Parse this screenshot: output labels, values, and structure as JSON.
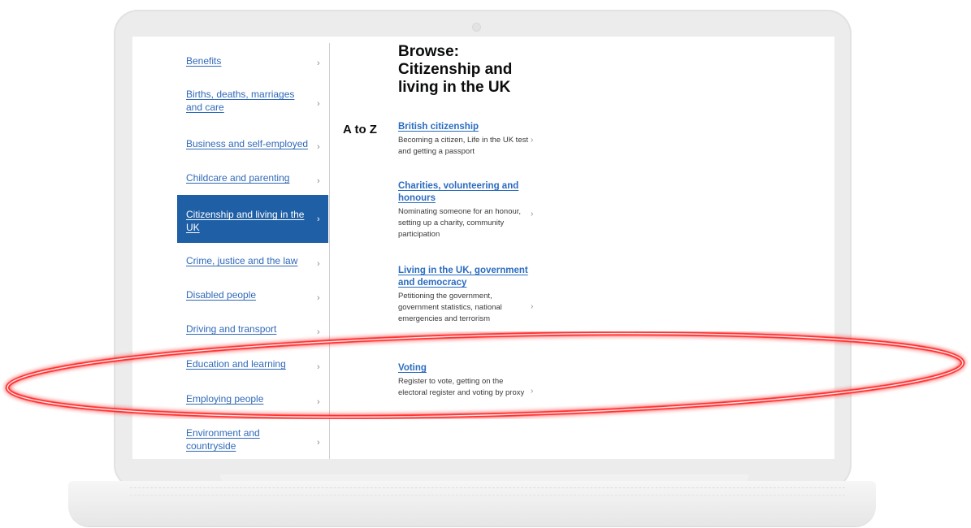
{
  "left_nav": {
    "items": [
      {
        "label": "Benefits",
        "chevron": "›",
        "active": false
      },
      {
        "label": "Births, deaths, marriages and care",
        "chevron": "›",
        "active": false
      },
      {
        "label": "Business and self-employed",
        "chevron": "›",
        "active": false
      },
      {
        "label": "Childcare and parenting",
        "chevron": "›",
        "active": false
      },
      {
        "label": "Citizenship and living in the UK",
        "chevron": "›",
        "active": true
      },
      {
        "label": "Crime, justice and the law",
        "chevron": "›",
        "active": false
      },
      {
        "label": "Disabled people",
        "chevron": "›",
        "active": false
      },
      {
        "label": "Driving and transport",
        "chevron": "›",
        "active": false
      },
      {
        "label": "Education and learning",
        "chevron": "›",
        "active": false
      },
      {
        "label": "Employing people",
        "chevron": "›",
        "active": false
      },
      {
        "label": "Environment and countryside",
        "chevron": "›",
        "active": false
      }
    ]
  },
  "main": {
    "title": "Browse: Citizenship and living in the UK",
    "atoz_label": "A to Z",
    "topics": [
      {
        "title": "British citizenship",
        "description": "Becoming a citizen, Life in the UK test and getting a passport",
        "chevron": "›"
      },
      {
        "title": "Charities, volunteering and honours",
        "description": "Nominating someone for an honour, setting up a charity, community participation",
        "chevron": "›"
      },
      {
        "title": "Living in the UK, government and democracy",
        "description": "Petitioning the government, government statistics, national emergencies and terrorism",
        "chevron": "›"
      },
      {
        "title": "Voting",
        "description": "Register to vote, getting on the electoral register and voting by proxy",
        "chevron": "›"
      }
    ]
  },
  "colors": {
    "link": "#3069b8",
    "active_background": "#1f5fa6",
    "highlight": "#ff1a1a"
  }
}
